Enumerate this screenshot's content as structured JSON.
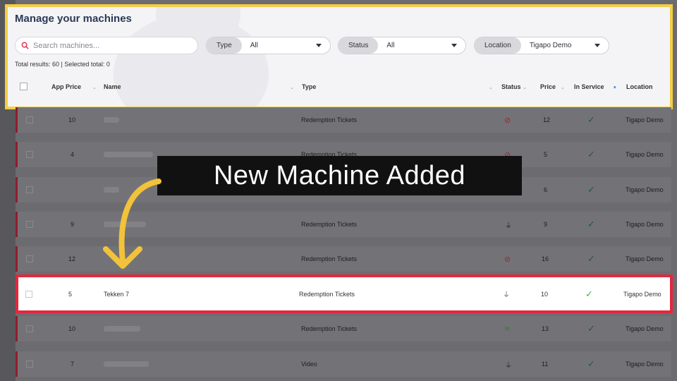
{
  "header": {
    "title": "Manage your machines",
    "results_text": "Total results: 60 | Selected total: 0"
  },
  "search": {
    "placeholder": "Search machines..."
  },
  "filters": {
    "type": {
      "label": "Type",
      "value": "All"
    },
    "status": {
      "label": "Status",
      "value": "All"
    },
    "location": {
      "label": "Location",
      "value": "Tigapo Demo"
    }
  },
  "columns": {
    "app_price": "App Price",
    "name": "Name",
    "type": "Type",
    "status": "Status",
    "price": "Price",
    "in_service": "In Service",
    "location": "Location"
  },
  "rows": [
    {
      "app_price": "10",
      "name": "",
      "type": "Redemption Tickets",
      "status_icon": "no-wifi-icon",
      "price": "12",
      "location": "Tigapo Demo"
    },
    {
      "app_price": "4",
      "name": "",
      "type": "Redemption Tickets",
      "status_icon": "no-wifi-icon",
      "price": "5",
      "location": "Tigapo Demo"
    },
    {
      "app_price": "",
      "name": "",
      "type": "",
      "status_icon": "",
      "price": "6",
      "location": "Tigapo Demo"
    },
    {
      "app_price": "9",
      "name": "",
      "type": "Redemption Tickets",
      "status_icon": "plug-icon",
      "price": "9",
      "location": "Tigapo Demo"
    },
    {
      "app_price": "12",
      "name": "",
      "type": "Redemption Tickets",
      "status_icon": "no-wifi-icon",
      "price": "16",
      "location": "Tigapo Demo"
    },
    {
      "app_price": "5",
      "name": "Tekken 7",
      "type": "Redemption Tickets",
      "status_icon": "plug-icon",
      "price": "10",
      "location": "Tigapo Demo"
    },
    {
      "app_price": "10",
      "name": "",
      "type": "Redemption Tickets",
      "status_icon": "wifi-icon",
      "price": "13",
      "location": "Tigapo Demo"
    },
    {
      "app_price": "7",
      "name": "",
      "type": "Video",
      "status_icon": "plug-icon",
      "price": "11",
      "location": "Tigapo Demo"
    }
  ],
  "banner": {
    "text": "New Machine Added"
  },
  "colors": {
    "highlight": "#e2283e",
    "header_border": "#f2cf45",
    "arrow": "#f2c23a",
    "check": "#44b04c"
  }
}
